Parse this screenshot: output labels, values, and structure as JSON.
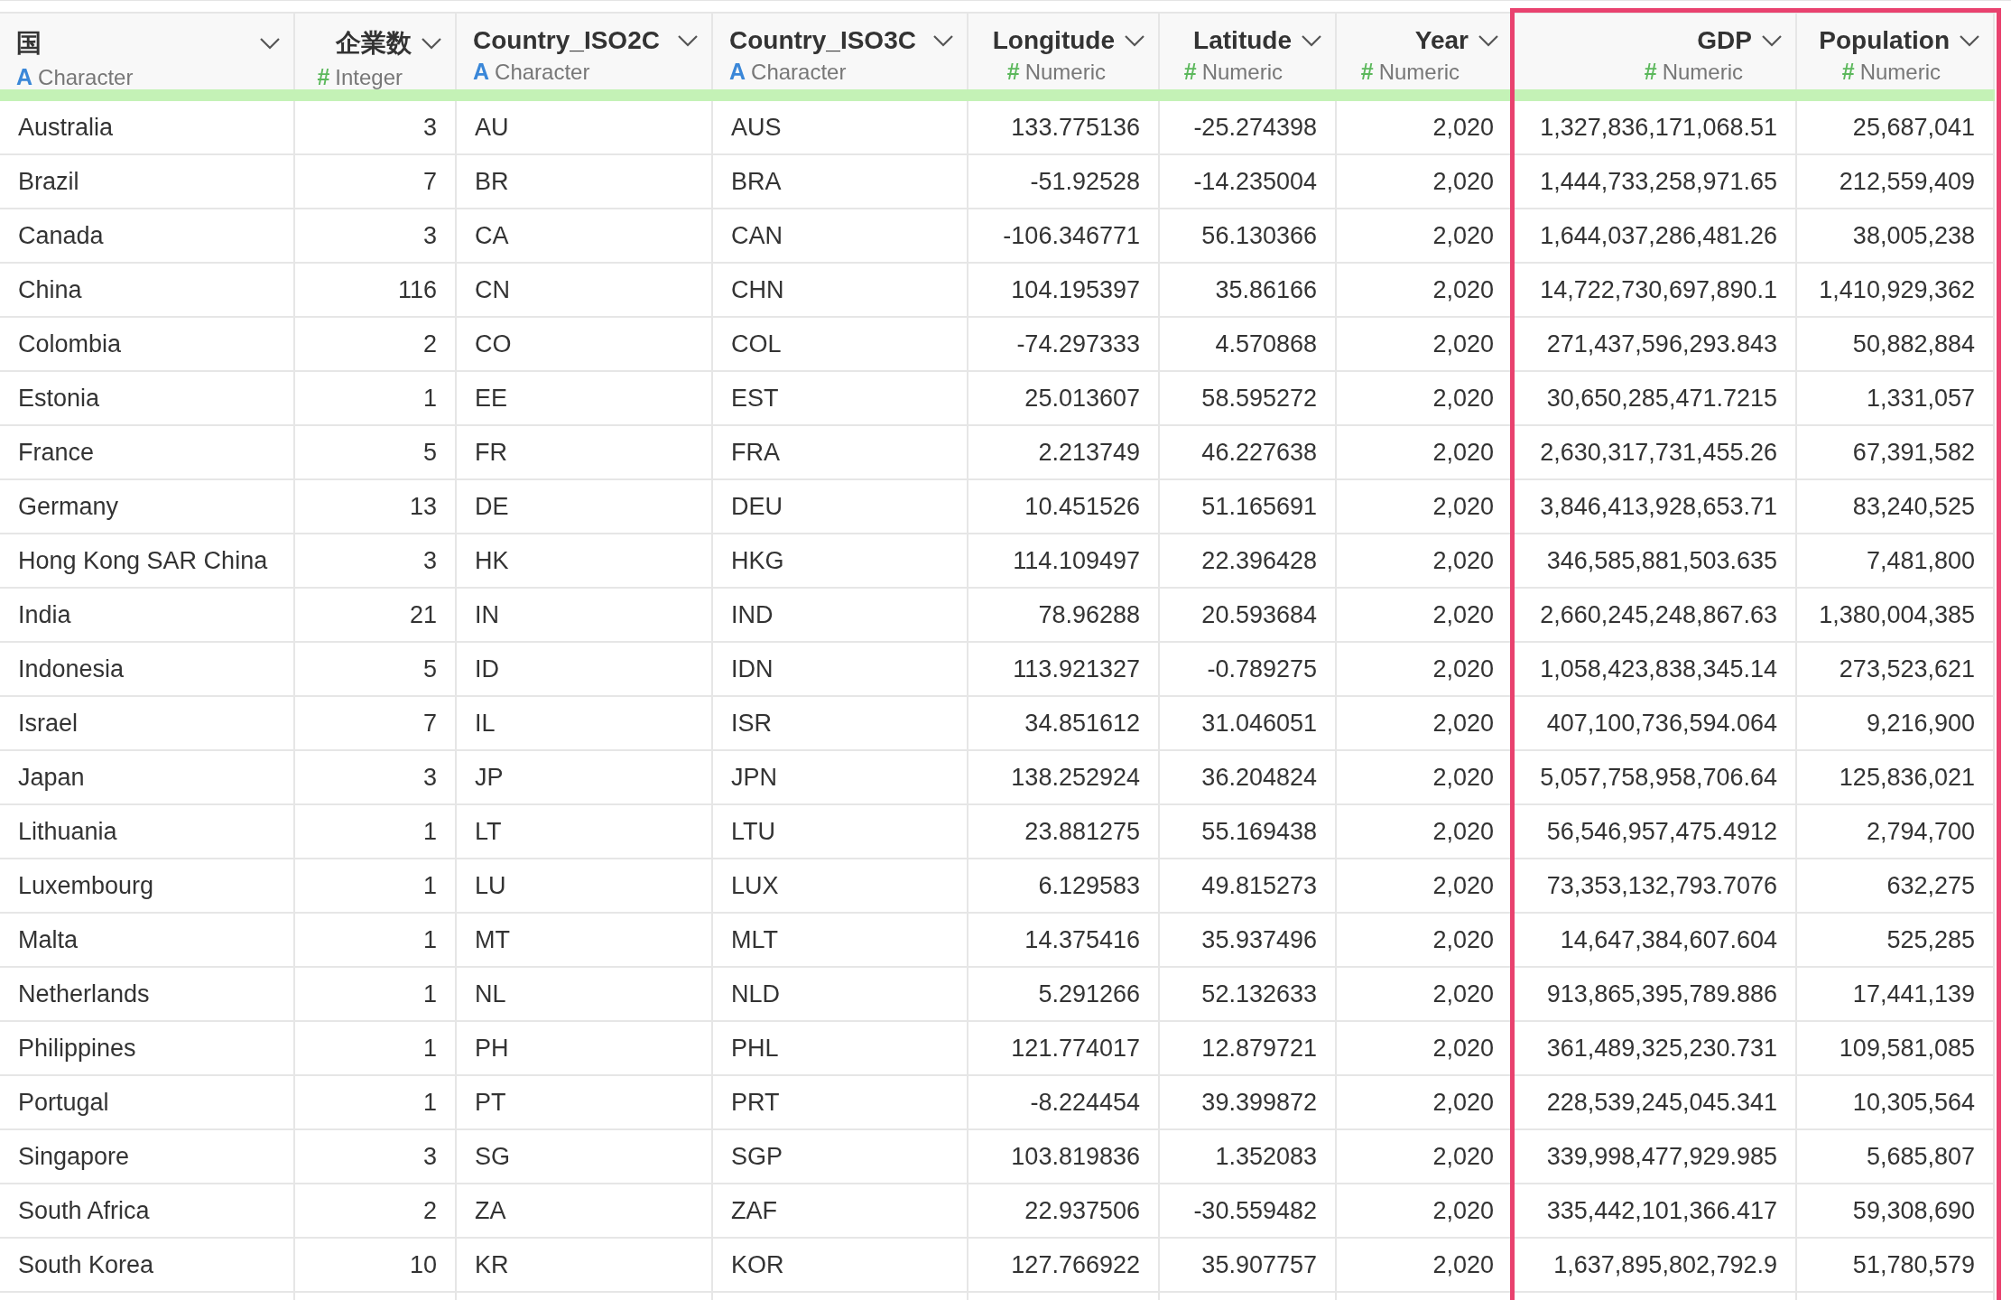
{
  "table": {
    "columns": [
      {
        "name": "国",
        "type": "Character",
        "type_mark": "A",
        "kind": "text",
        "highlighted": false
      },
      {
        "name": "企業数",
        "type": "Integer",
        "type_mark": "#",
        "kind": "number",
        "highlighted": false
      },
      {
        "name": "Country_ISO2C",
        "type": "Character",
        "type_mark": "A",
        "kind": "text",
        "highlighted": false
      },
      {
        "name": "Country_ISO3C",
        "type": "Character",
        "type_mark": "A",
        "kind": "text",
        "highlighted": false
      },
      {
        "name": "Longitude",
        "type": "Numeric",
        "type_mark": "#",
        "kind": "number",
        "highlighted": false
      },
      {
        "name": "Latitude",
        "type": "Numeric",
        "type_mark": "#",
        "kind": "number",
        "highlighted": false
      },
      {
        "name": "Year",
        "type": "Numeric",
        "type_mark": "#",
        "kind": "number",
        "highlighted": false
      },
      {
        "name": "GDP",
        "type": "Numeric",
        "type_mark": "#",
        "kind": "number",
        "highlighted": true
      },
      {
        "name": "Population",
        "type": "Numeric",
        "type_mark": "#",
        "kind": "number",
        "highlighted": true
      }
    ],
    "rows": [
      [
        "Australia",
        "3",
        "AU",
        "AUS",
        "133.775136",
        "-25.274398",
        "2,020",
        "1,327,836,171,068.51",
        "25,687,041"
      ],
      [
        "Brazil",
        "7",
        "BR",
        "BRA",
        "-51.92528",
        "-14.235004",
        "2,020",
        "1,444,733,258,971.65",
        "212,559,409"
      ],
      [
        "Canada",
        "3",
        "CA",
        "CAN",
        "-106.346771",
        "56.130366",
        "2,020",
        "1,644,037,286,481.26",
        "38,005,238"
      ],
      [
        "China",
        "116",
        "CN",
        "CHN",
        "104.195397",
        "35.86166",
        "2,020",
        "14,722,730,697,890.1",
        "1,410,929,362"
      ],
      [
        "Colombia",
        "2",
        "CO",
        "COL",
        "-74.297333",
        "4.570868",
        "2,020",
        "271,437,596,293.843",
        "50,882,884"
      ],
      [
        "Estonia",
        "1",
        "EE",
        "EST",
        "25.013607",
        "58.595272",
        "2,020",
        "30,650,285,471.7215",
        "1,331,057"
      ],
      [
        "France",
        "5",
        "FR",
        "FRA",
        "2.213749",
        "46.227638",
        "2,020",
        "2,630,317,731,455.26",
        "67,391,582"
      ],
      [
        "Germany",
        "13",
        "DE",
        "DEU",
        "10.451526",
        "51.165691",
        "2,020",
        "3,846,413,928,653.71",
        "83,240,525"
      ],
      [
        "Hong Kong SAR China",
        "3",
        "HK",
        "HKG",
        "114.109497",
        "22.396428",
        "2,020",
        "346,585,881,503.635",
        "7,481,800"
      ],
      [
        "India",
        "21",
        "IN",
        "IND",
        "78.96288",
        "20.593684",
        "2,020",
        "2,660,245,248,867.63",
        "1,380,004,385"
      ],
      [
        "Indonesia",
        "5",
        "ID",
        "IDN",
        "113.921327",
        "-0.789275",
        "2,020",
        "1,058,423,838,345.14",
        "273,523,621"
      ],
      [
        "Israel",
        "7",
        "IL",
        "ISR",
        "34.851612",
        "31.046051",
        "2,020",
        "407,100,736,594.064",
        "9,216,900"
      ],
      [
        "Japan",
        "3",
        "JP",
        "JPN",
        "138.252924",
        "36.204824",
        "2,020",
        "5,057,758,958,706.64",
        "125,836,021"
      ],
      [
        "Lithuania",
        "1",
        "LT",
        "LTU",
        "23.881275",
        "55.169438",
        "2,020",
        "56,546,957,475.4912",
        "2,794,700"
      ],
      [
        "Luxembourg",
        "1",
        "LU",
        "LUX",
        "6.129583",
        "49.815273",
        "2,020",
        "73,353,132,793.7076",
        "632,275"
      ],
      [
        "Malta",
        "1",
        "MT",
        "MLT",
        "14.375416",
        "35.937496",
        "2,020",
        "14,647,384,607.604",
        "525,285"
      ],
      [
        "Netherlands",
        "1",
        "NL",
        "NLD",
        "5.291266",
        "52.132633",
        "2,020",
        "913,865,395,789.886",
        "17,441,139"
      ],
      [
        "Philippines",
        "1",
        "PH",
        "PHL",
        "121.774017",
        "12.879721",
        "2,020",
        "361,489,325,230.731",
        "109,581,085"
      ],
      [
        "Portugal",
        "1",
        "PT",
        "PRT",
        "-8.224454",
        "39.399872",
        "2,020",
        "228,539,245,045.341",
        "10,305,564"
      ],
      [
        "Singapore",
        "3",
        "SG",
        "SGP",
        "103.819836",
        "1.352083",
        "2,020",
        "339,998,477,929.985",
        "5,685,807"
      ],
      [
        "South Africa",
        "2",
        "ZA",
        "ZAF",
        "22.937506",
        "-30.559482",
        "2,020",
        "335,442,101,366.417",
        "59,308,690"
      ],
      [
        "South Korea",
        "10",
        "KR",
        "KOR",
        "127.766922",
        "35.907757",
        "2,020",
        "1,637,895,802,792.9",
        "51,780,579"
      ]
    ]
  }
}
